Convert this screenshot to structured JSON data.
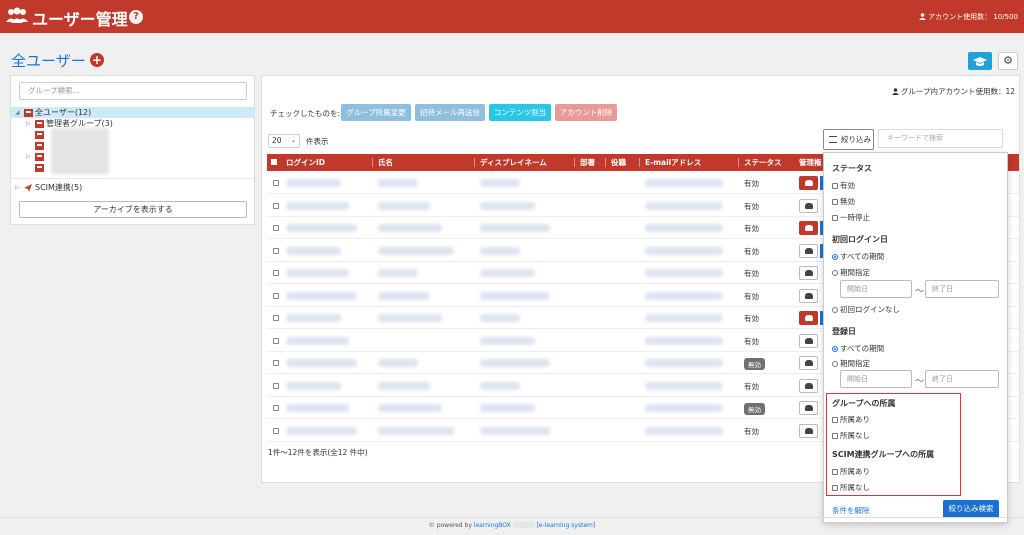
{
  "header": {
    "title": "ユーザー管理",
    "help": "?",
    "account_usage": "アカウント使用数： 10/500"
  },
  "page": {
    "title": "全ユーザー",
    "add": "+"
  },
  "left": {
    "search_placeholder": "グループ検索...",
    "tree": [
      {
        "label": "全ユーザー(12)"
      },
      {
        "label": "管理者グループ(3)"
      },
      {
        "label": "SCIM連携(5)"
      }
    ],
    "archive_button": "アーカイブを表示する"
  },
  "main": {
    "group_account_usage": "グループ内アカウント使用数：12",
    "checked_label": "チェックしたものを:",
    "actions": [
      "グループ所属変更",
      "招待メール再送信",
      "コンテンツ割当",
      "アカウント削除"
    ],
    "per_page": "20",
    "per_page_label": "件表示",
    "filter_button": "絞り込み",
    "keyword_placeholder": "キーワードで検索",
    "columns": [
      "ログインID",
      "氏名",
      "ディスプレイネーム",
      "部署",
      "役職",
      "E-mailアドレス",
      "ステータス",
      "管理権"
    ],
    "rows": [
      {
        "status": "有効",
        "badge": false,
        "manager": true
      },
      {
        "status": "有効",
        "badge": false,
        "manager": false
      },
      {
        "status": "有効",
        "badge": false,
        "manager": true
      },
      {
        "status": "有効",
        "badge": false,
        "manager": false
      },
      {
        "status": "有効",
        "badge": false,
        "manager": false
      },
      {
        "status": "有効",
        "badge": false,
        "manager": false
      },
      {
        "status": "有効",
        "badge": false,
        "manager": true
      },
      {
        "status": "有効",
        "badge": false,
        "manager": false
      },
      {
        "status": "無効",
        "badge": true,
        "manager": false
      },
      {
        "status": "有効",
        "badge": false,
        "manager": false
      },
      {
        "status": "無効",
        "badge": true,
        "manager": false
      },
      {
        "status": "有効",
        "badge": false,
        "manager": false
      }
    ],
    "footer": "1件～12件を表示(全12 件中)"
  },
  "filter": {
    "status_heading": "ステータス",
    "status_options": [
      "有効",
      "無効",
      "一時停止"
    ],
    "first_login_heading": "初回ログイン日",
    "first_login_options": [
      "すべての期間",
      "期間指定",
      "初回ログインなし"
    ],
    "start_placeholder": "開始日",
    "end_placeholder": "終了日",
    "tilde": "〜",
    "registered_heading": "登録日",
    "registered_options": [
      "すべての期間",
      "期間指定"
    ],
    "group_heading": "グループへの所属",
    "group_options": [
      "所属あり",
      "所属なし"
    ],
    "scim_heading": "SCIM連携グループへの所属",
    "scim_options": [
      "所属あり",
      "所属なし"
    ],
    "clear": "条件を解除",
    "apply": "絞り込み検索"
  },
  "footer": {
    "powered_prefix": "© powered by",
    "brand": "learningBOX",
    "tagline": "[e-learning system]"
  },
  "colors": {
    "brand": "#c0392b",
    "link": "#1a73e8",
    "action_blue": "#8fbfdd",
    "action_cyan": "#29c6e6",
    "action_red": "#e89b96",
    "highlight": "#d9363e"
  }
}
